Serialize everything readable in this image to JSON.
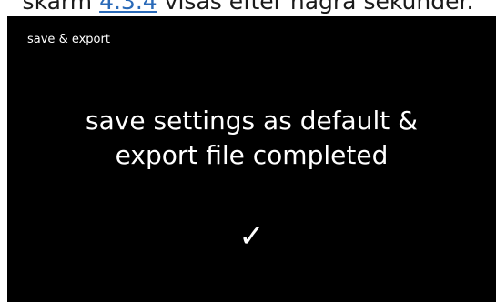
{
  "document": {
    "text_before_link": "skärm",
    "link_text": "4.3.4",
    "text_after_link": "visas efter några sekunder."
  },
  "screen": {
    "title": "save & export",
    "message_line1": "save settings as default &",
    "message_line2": "export file completed",
    "check_icon": "checkmark-icon",
    "check_glyph": "✓",
    "background_color": "#000000",
    "text_color": "#ffffff"
  }
}
